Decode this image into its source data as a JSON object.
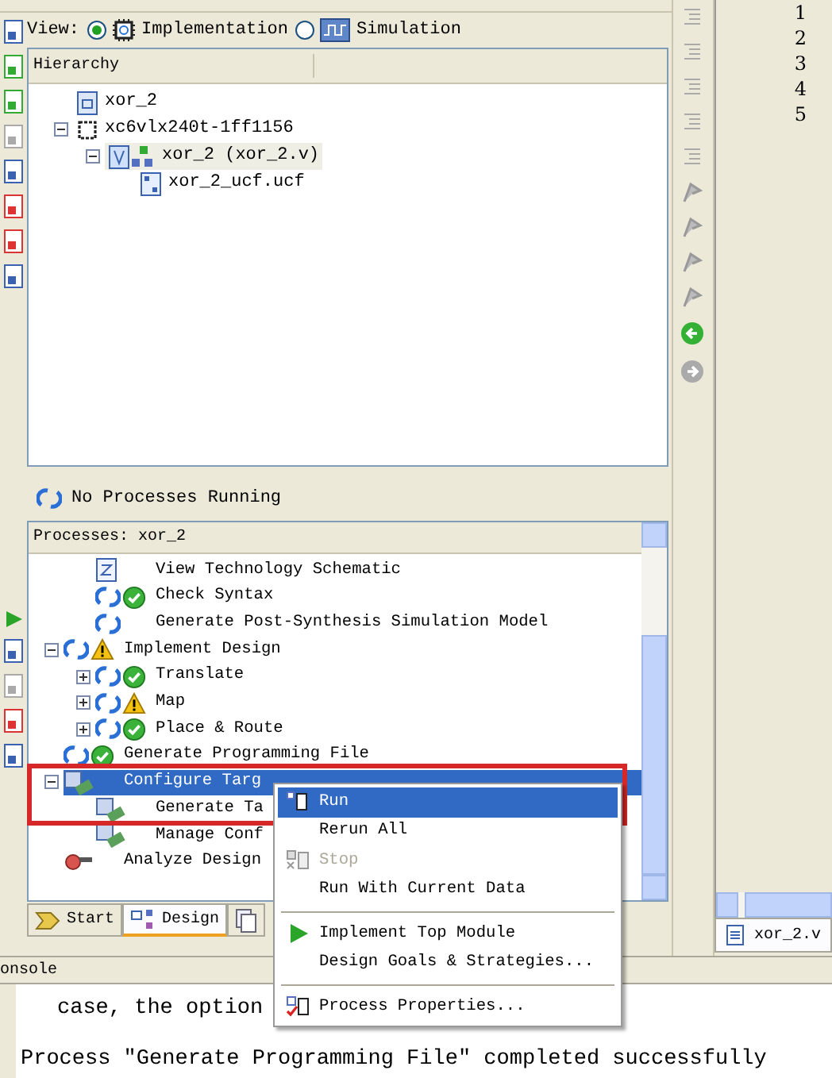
{
  "view": {
    "label": "View:",
    "options": [
      {
        "label": "Implementation",
        "selected": true
      },
      {
        "label": "Simulation",
        "selected": false
      }
    ]
  },
  "hierarchy": {
    "title": "Hierarchy",
    "items": [
      {
        "label": "xor_2",
        "kind": "project",
        "selected": false
      },
      {
        "label": "xc6vlx240t-1ff1156",
        "kind": "device",
        "expanded": true,
        "selected": false,
        "children": [
          {
            "label": "xor_2 (xor_2.v)",
            "kind": "verilog",
            "expanded": true,
            "selected": true,
            "children": [
              {
                "label": "xor_2_ucf.ucf",
                "kind": "constraints",
                "selected": false
              }
            ]
          }
        ]
      }
    ]
  },
  "process_status": "No Processes Running",
  "processes": {
    "title": "Processes: xor_2",
    "items": [
      {
        "children": [
          {
            "label": "View Technology Schematic",
            "kind": "schematic",
            "completed": false,
            "warning": false,
            "selected": false
          },
          {
            "label": "Check Syntax",
            "kind": "process",
            "completed": true,
            "warning": false,
            "selected": false
          },
          {
            "label": "Generate Post-Synthesis Simulation Model",
            "kind": "process",
            "completed": false,
            "warning": false,
            "selected": false
          }
        ]
      },
      {
        "label": "Implement Design",
        "kind": "process",
        "completed": false,
        "warning": true,
        "expanded": true,
        "selected": false,
        "children": [
          {
            "label": "Translate",
            "kind": "process",
            "completed": true,
            "warning": false,
            "expanded": false,
            "selected": false
          },
          {
            "label": "Map",
            "kind": "process",
            "completed": false,
            "warning": true,
            "expanded": false,
            "selected": false
          },
          {
            "label": "Place & Route",
            "kind": "process",
            "completed": true,
            "warning": false,
            "expanded": false,
            "selected": false
          }
        ]
      },
      {
        "label": "Generate Programming File",
        "kind": "process",
        "completed": true,
        "warning": false,
        "selected": false
      },
      {
        "label": "Configure Targ",
        "kind": "configure",
        "completed": false,
        "warning": false,
        "expanded": true,
        "selected": true,
        "children": [
          {
            "label": "Generate Ta",
            "kind": "configure",
            "completed": false,
            "warning": false,
            "selected": false
          },
          {
            "label": "Manage Conf",
            "kind": "configure",
            "completed": false,
            "warning": false,
            "selected": false
          }
        ]
      },
      {
        "label": "Analyze Design",
        "kind": "analyze",
        "completed": false,
        "warning": false,
        "selected": false
      }
    ]
  },
  "bottom_tabs": [
    {
      "label": "Start",
      "selected": false
    },
    {
      "label": "Design",
      "selected": true
    },
    {
      "selected": false
    }
  ],
  "editor": {
    "line_numbers": [
      "1",
      "2",
      "3",
      "4",
      "5"
    ],
    "tab": "xor_2.v"
  },
  "console": {
    "title": "onsole",
    "lines": [
      "case, the option",
      "Process \"Generate Programming File\" completed successfully"
    ]
  },
  "context_menu": {
    "items": [
      {
        "kind": "item",
        "label": "Run",
        "selected": true,
        "disabled": false
      },
      {
        "kind": "item",
        "label": "Rerun All",
        "selected": false,
        "disabled": false
      },
      {
        "kind": "item",
        "label": "Stop",
        "selected": false,
        "disabled": true
      },
      {
        "kind": "item",
        "label": "Run With Current Data",
        "selected": false,
        "disabled": false
      },
      {
        "kind": "separator"
      },
      {
        "kind": "item",
        "label": "Implement Top Module",
        "selected": false,
        "disabled": false
      },
      {
        "kind": "item",
        "label": "Design Goals & Strategies...",
        "selected": false,
        "disabled": false
      },
      {
        "kind": "separator"
      },
      {
        "kind": "item",
        "label": "Process Properties...",
        "selected": false,
        "disabled": false
      }
    ]
  }
}
